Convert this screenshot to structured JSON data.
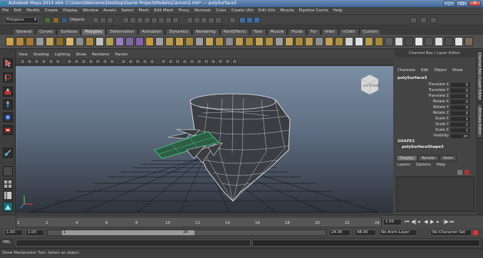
{
  "window": {
    "title": "Autodesk Maya 2014 x64: C:\\Users\\Welcome\\Desktop\\Game Project\\Models\\Cannon2.mb* --- polySurface3",
    "minimize": "_",
    "maximize": "□",
    "close": "X"
  },
  "menubar": [
    "File",
    "Edit",
    "Modify",
    "Create",
    "Display",
    "Window",
    "Assets",
    "Select",
    "Mesh",
    "Edit Mesh",
    "Proxy",
    "Normals",
    "Color",
    "Create UVs",
    "Edit UVs",
    "Muscle",
    "Pipeline Cache",
    "Help"
  ],
  "statusline": {
    "mode_selector": "Polygons",
    "selection_mask": "Objects"
  },
  "shelf": {
    "tabs": [
      "General",
      "Curves",
      "Surfaces",
      "Polygons",
      "Deformation",
      "Animation",
      "Dynamics",
      "Rendering",
      "PaintEffects",
      "Toon",
      "Muscle",
      "Fluids",
      "Fur",
      "nHair",
      "nCloth",
      "Custom"
    ],
    "active_tab": "Polygons"
  },
  "panel": {
    "menus": [
      "View",
      "Shading",
      "Lighting",
      "Show",
      "Renderer",
      "Panels"
    ],
    "viewcube": {
      "left": "LEFT",
      "front": "FRONT"
    }
  },
  "channel_box": {
    "header": "Channel Box / Layer Editor",
    "menus": [
      "Channels",
      "Edit",
      "Object",
      "Show"
    ],
    "object_name": "polySurface3",
    "attributes": [
      {
        "name": "Translate X",
        "value": "0"
      },
      {
        "name": "Translate Y",
        "value": "0"
      },
      {
        "name": "Translate Z",
        "value": "0"
      },
      {
        "name": "Rotate X",
        "value": "0"
      },
      {
        "name": "Rotate Y",
        "value": "0"
      },
      {
        "name": "Rotate Z",
        "value": "0"
      },
      {
        "name": "Scale X",
        "value": "1"
      },
      {
        "name": "Scale Y",
        "value": "1"
      },
      {
        "name": "Scale Z",
        "value": "1"
      },
      {
        "name": "Visibility",
        "value": "on"
      }
    ],
    "shapes_label": "SHAPES",
    "shape_name": "polySurfaceShape3",
    "layer_tabs": [
      "Display",
      "Render",
      "Anim"
    ],
    "layer_menus": [
      "Layers",
      "Options",
      "Help"
    ]
  },
  "side_tabs": [
    "Channel Box / Layer Editor",
    "Attribute Editor"
  ],
  "timeslider": {
    "ticks": [
      "2",
      "4",
      "6",
      "8",
      "10",
      "12",
      "14",
      "16",
      "18",
      "20",
      "22",
      "24"
    ],
    "current_frame": "1.00",
    "marker": "1"
  },
  "rangeslider": {
    "start": "1.00",
    "inner_start": "1.00",
    "range_marker_start": "1",
    "range_marker_end": "24",
    "end": "24.00",
    "anim_end": "48.00",
    "anim_layer": "No Anim Layer",
    "character_set": "No Character Set"
  },
  "cmdline": {
    "label": "MEL"
  },
  "helpline": {
    "text": "Show Manipulator Tool: Select an object."
  },
  "colors": {
    "viewport_top": "#7a8ea5",
    "viewport_bottom": "#2e333b",
    "wireframe": "#e8e8e8",
    "selected_wire": "#39d67a",
    "mesh_fill": "#3a3d42"
  }
}
